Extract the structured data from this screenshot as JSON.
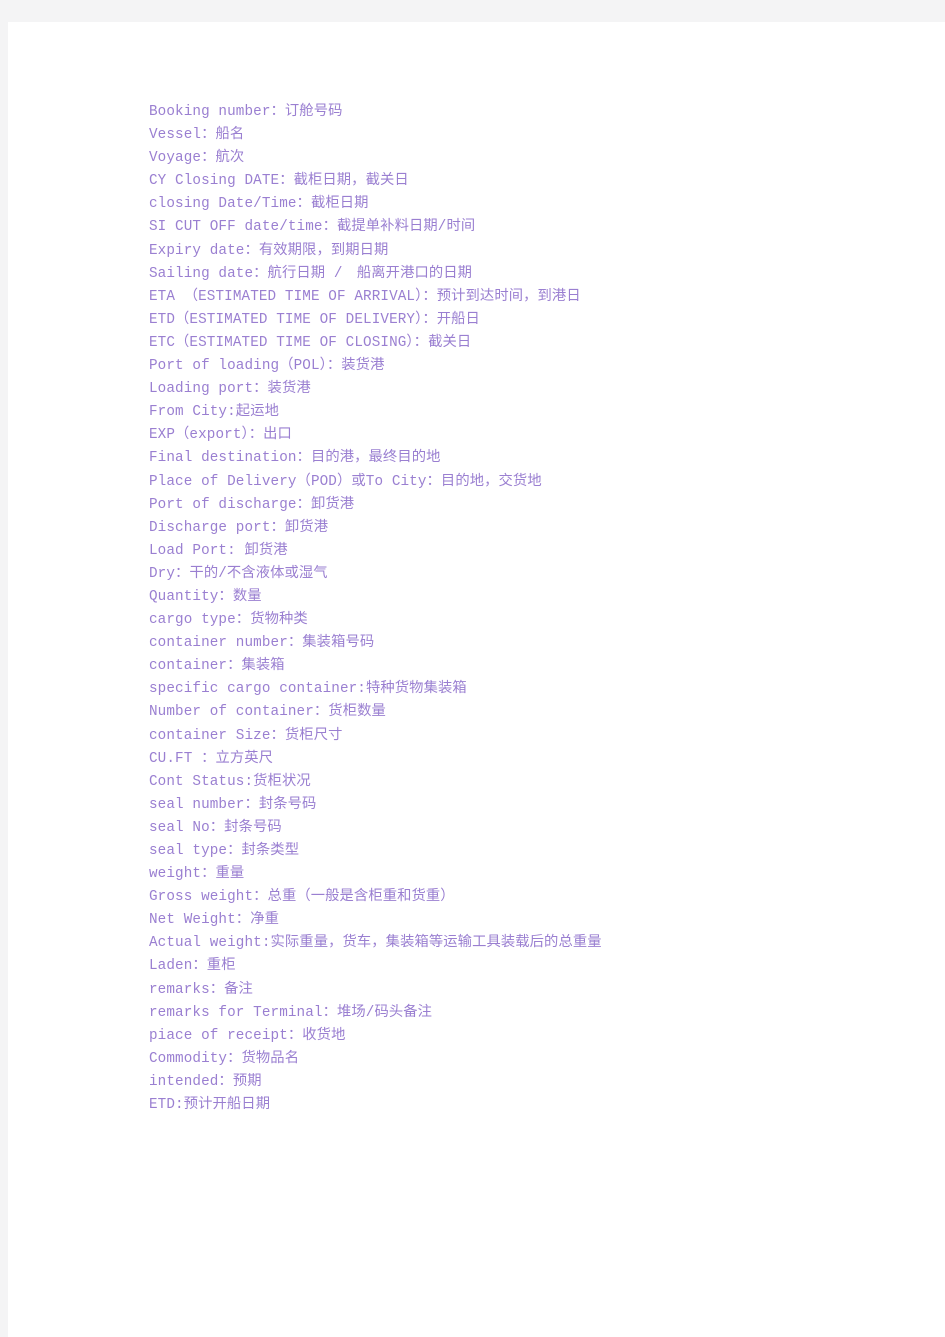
{
  "document": {
    "title": "Shipping / Freight Forwarding Terms Glossary",
    "page_background": "#ffffff",
    "gutter_color": "#f4f4f5",
    "text_color": "#9a7fd1",
    "line_count": 47
  },
  "lines": [
    {
      "text": "Booking number：订舱号码"
    },
    {
      "text": "Vessel：船名"
    },
    {
      "text": "Voyage：航次"
    },
    {
      "text": "CY Closing DATE：截柜日期，截关日"
    },
    {
      "text": "closing Date/Time：截柜日期"
    },
    {
      "text": "SI CUT OFF date/time：截提单补料日期/时间"
    },
    {
      "text": "Expiry date：有效期限，到期日期"
    },
    {
      "text": "Sailing date：航行日期 /　船离开港口的日期"
    },
    {
      "text": "ETA （ESTIMATED TIME OF ARRIVAL）：预计到达时间，到港日"
    },
    {
      "text": "ETD（ESTIMATED TIME OF DELIVERY）：开船日"
    },
    {
      "text": "ETC（ESTIMATED TIME OF CLOSING）：截关日"
    },
    {
      "text": "Port of loading（POL）：装货港"
    },
    {
      "text": "Loading port：装货港"
    },
    {
      "text": "From City:起运地"
    },
    {
      "text": "EXP（export）：出口"
    },
    {
      "text": "Final destination：目的港，最终目的地"
    },
    {
      "text": "Place of Delivery（POD）或To City：目的地，交货地"
    },
    {
      "text": "Port of discharge：卸货港"
    },
    {
      "text": "Discharge port：卸货港"
    },
    {
      "text": "Load Port: 卸货港"
    },
    {
      "text": "Dry：干的/不含液体或湿气"
    },
    {
      "text": "Quantity：数量"
    },
    {
      "text": "cargo type：货物种类"
    },
    {
      "text": "container number：集装箱号码"
    },
    {
      "text": "container：集装箱"
    },
    {
      "text": "specific cargo container:特种货物集装箱"
    },
    {
      "text": "Number of container：货柜数量"
    },
    {
      "text": "container Size：货柜尺寸"
    },
    {
      "text": "CU.FT ：立方英尺"
    },
    {
      "text": "Cont Status:货柜状况"
    },
    {
      "text": "seal number：封条号码"
    },
    {
      "text": "seal No：封条号码"
    },
    {
      "text": "seal type：封条类型"
    },
    {
      "text": "weight：重量"
    },
    {
      "text": "Gross weight：总重（一般是含柜重和货重）"
    },
    {
      "text": "Net Weight：净重"
    },
    {
      "text": "Actual weight:实际重量，货车，集装箱等运输工具装载后的总重量"
    },
    {
      "text": "Laden：重柜"
    },
    {
      "text": "remarks：备注"
    },
    {
      "text": "remarks for Terminal：堆场/码头备注"
    },
    {
      "text": "piace of receipt：收货地"
    },
    {
      "text": "Commodity：货物品名"
    },
    {
      "text": "intended：预期"
    },
    {
      "text": "ETD:预计开船日期"
    }
  ]
}
